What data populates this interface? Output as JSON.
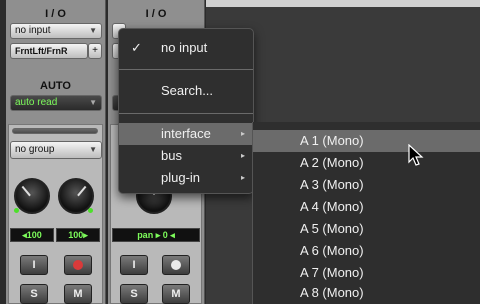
{
  "strip1": {
    "io_header": "I / O",
    "input": "no input",
    "output": "FrntLft/FrnR",
    "output_link": "+",
    "auto_header": "AUTO",
    "auto_mode": "auto read",
    "group": "no group",
    "pan_left": "100",
    "pan_right": "100",
    "insert_label": "I",
    "solo_label": "S",
    "mute_label": "M"
  },
  "strip2": {
    "io_header": "I / O",
    "pan_mode": "pan",
    "pan_value": "0",
    "insert_label": "I",
    "solo_label": "S",
    "mute_label": "M"
  },
  "menu": {
    "items": [
      {
        "label": "no input",
        "checked": true
      },
      {
        "label": "Search..."
      },
      {
        "label": "interface",
        "submenu": true,
        "highlighted": true
      },
      {
        "label": "bus",
        "submenu": true
      },
      {
        "label": "plug-in",
        "submenu": true
      }
    ],
    "check_mark": "✓",
    "submenu_arrow": "▸"
  },
  "submenu": {
    "items": [
      {
        "label": "A 1 (Mono)",
        "highlighted": true
      },
      {
        "label": "A 2 (Mono)"
      },
      {
        "label": "A 3 (Mono)"
      },
      {
        "label": "A 4 (Mono)"
      },
      {
        "label": "A 5 (Mono)"
      },
      {
        "label": "A 6 (Mono)"
      },
      {
        "label": "A 7 (Mono)"
      },
      {
        "label": "A 8 (Mono)"
      }
    ]
  },
  "colors": {
    "accent_green": "#7dfc5b",
    "record_red": "#d93a3a",
    "menu_highlight": "#6b6b6b"
  }
}
